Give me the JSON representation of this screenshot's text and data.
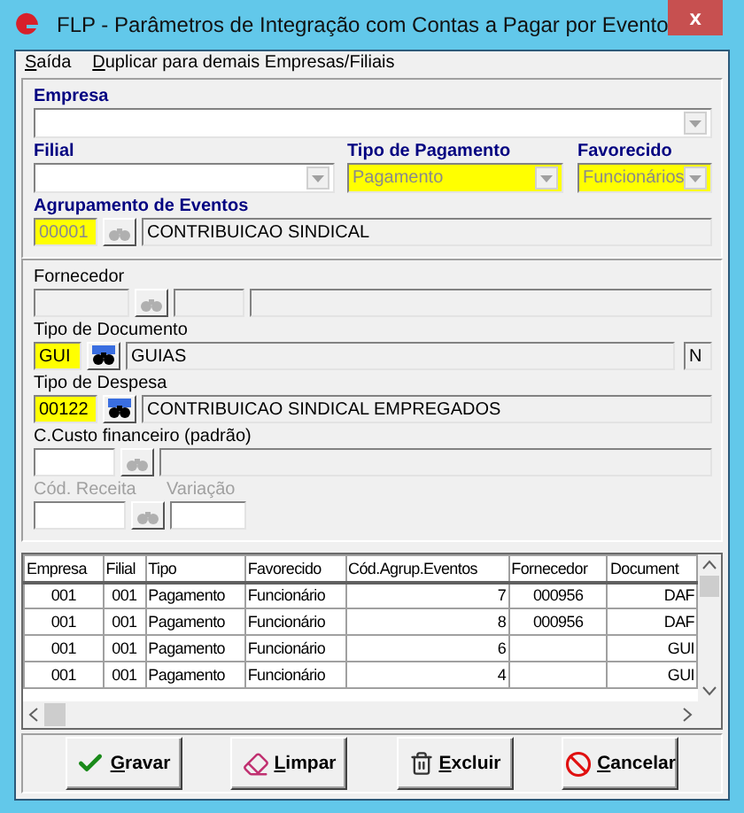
{
  "window": {
    "title": "FLP - Parâmetros de Integração com Contas a Pagar por Evento",
    "close": "x"
  },
  "menu": [
    "Saída",
    "Duplicar para demais Empresas/Filiais"
  ],
  "header": {
    "empresa": {
      "label": "Empresa"
    },
    "filial": {
      "label": "Filial"
    },
    "tipo_pagamento": {
      "label": "Tipo de Pagamento",
      "value": "Pagamento",
      "required": true,
      "disabled": true
    },
    "favorecido": {
      "label": "Favorecido",
      "value": "Funcionários",
      "required": true,
      "disabled": true
    },
    "agrupamento": {
      "label": "Agrupamento de Eventos",
      "code": "00001",
      "description": "CONTRIBUICAO SINDICAL",
      "required": true,
      "search_enabled": false
    }
  },
  "details": {
    "fornecedor": {
      "label": "Fornecedor",
      "editable": false,
      "search_enabled": false
    },
    "tipo_documento": {
      "label": "Tipo de Documento",
      "code": "GUI",
      "description": "GUIAS",
      "flag": "N",
      "required": true,
      "search_enabled": true
    },
    "tipo_despesa": {
      "label": "Tipo de Despesa",
      "code": "00122",
      "description": "CONTRIBUICAO SINDICAL EMPREGADOS",
      "required": true,
      "search_enabled": true
    },
    "centro_custo": {
      "label": "C.Custo financeiro (padrão)",
      "search_enabled": false
    },
    "cod_receita": {
      "label": "Cód. Receita",
      "disabled": true,
      "search_enabled": false
    },
    "variacao": {
      "label": "Variação",
      "disabled": true
    }
  },
  "table": {
    "columns": [
      "Empresa",
      "Filial",
      "Tipo",
      "Favorecido",
      "Cód.Agrup.Eventos",
      "Fornecedor",
      "Document"
    ],
    "rows": [
      [
        "001",
        "001",
        "Pagamento",
        "Funcionário",
        "7",
        "000956",
        "DAF"
      ],
      [
        "001",
        "001",
        "Pagamento",
        "Funcionário",
        "8",
        "000956",
        "DAF"
      ],
      [
        "001",
        "001",
        "Pagamento",
        "Funcionário",
        "6",
        "",
        "GUI"
      ],
      [
        "001",
        "001",
        "Pagamento",
        "Funcionário",
        "4",
        "",
        "GUI"
      ]
    ]
  },
  "buttons": [
    {
      "label": "Gravar",
      "kind": "save"
    },
    {
      "label": "Limpar",
      "kind": "clear"
    },
    {
      "label": "Excluir",
      "kind": "delete"
    },
    {
      "label": "Cancelar",
      "kind": "cancel"
    }
  ]
}
